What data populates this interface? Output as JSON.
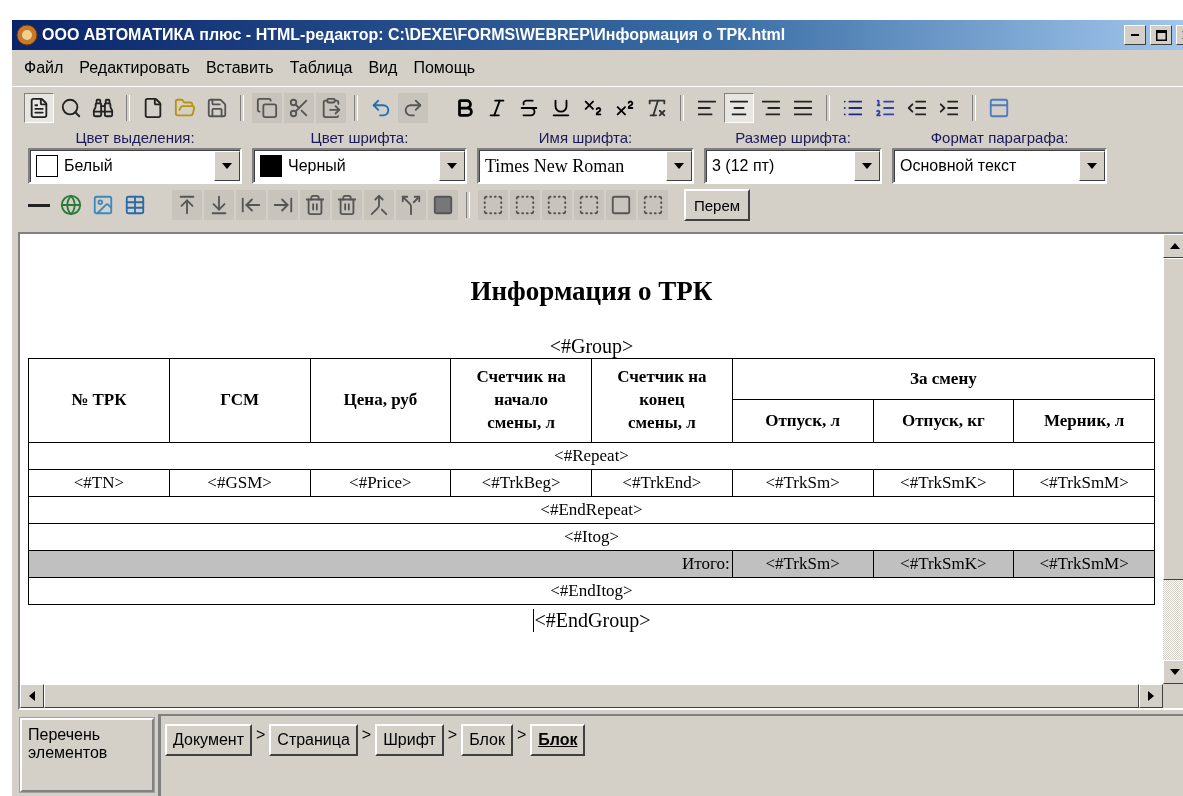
{
  "window": {
    "title": "ООО АВТОМАТИКА плюс - HTML-редактор: C:\\DEXE\\FORMS\\WEBREP\\Информация о ТРК.html"
  },
  "menu": [
    "Файл",
    "Редактировать",
    "Вставить",
    "Таблица",
    "Вид",
    "Помощь"
  ],
  "toolbar": [
    [
      {
        "kind": "edit-mode",
        "pressed": true,
        "disabled": false
      },
      {
        "kind": "preview",
        "pressed": false,
        "disabled": false
      },
      {
        "kind": "find",
        "pressed": false,
        "disabled": false
      }
    ],
    [
      {
        "kind": "new",
        "pressed": false,
        "disabled": false
      },
      {
        "kind": "open",
        "pressed": false,
        "disabled": false
      },
      {
        "kind": "save",
        "pressed": false,
        "disabled": false
      }
    ],
    [
      {
        "kind": "copy",
        "pressed": false,
        "disabled": true
      },
      {
        "kind": "cut",
        "pressed": false,
        "disabled": true
      },
      {
        "kind": "paste",
        "pressed": false,
        "disabled": true
      }
    ],
    [
      {
        "kind": "undo",
        "pressed": false,
        "disabled": false
      },
      {
        "kind": "redo",
        "pressed": false,
        "disabled": true
      }
    ],
    [
      {
        "kind": "bold",
        "pressed": false,
        "disabled": false
      },
      {
        "kind": "italic",
        "pressed": false,
        "disabled": false
      },
      {
        "kind": "strike",
        "pressed": false,
        "disabled": false
      },
      {
        "kind": "underline",
        "pressed": false,
        "disabled": false
      },
      {
        "kind": "subscript",
        "pressed": false,
        "disabled": false
      },
      {
        "kind": "superscript",
        "pressed": false,
        "disabled": false
      },
      {
        "kind": "clear-format",
        "pressed": false,
        "disabled": false
      }
    ],
    [
      {
        "kind": "align-left",
        "pressed": false,
        "disabled": false
      },
      {
        "kind": "align-center",
        "pressed": true,
        "disabled": false
      },
      {
        "kind": "align-right",
        "pressed": false,
        "disabled": false
      },
      {
        "kind": "justify",
        "pressed": false,
        "disabled": false
      }
    ],
    [
      {
        "kind": "bullets",
        "pressed": false,
        "disabled": false
      },
      {
        "kind": "numbering",
        "pressed": false,
        "disabled": false
      },
      {
        "kind": "outdent",
        "pressed": false,
        "disabled": false
      },
      {
        "kind": "indent",
        "pressed": false,
        "disabled": false
      }
    ],
    [
      {
        "kind": "layout",
        "pressed": false,
        "disabled": false
      }
    ]
  ],
  "selectors": [
    {
      "label": "Цвет выделения:",
      "value": "Белый",
      "color": "#ffffff"
    },
    {
      "label": "Цвет шрифта:",
      "value": "Черный",
      "color": "#000000"
    },
    {
      "label": "Имя шрифта:",
      "value": "Times New Roman",
      "kind": "font"
    },
    {
      "label": "Размер шрифта:",
      "value": "3 (12 пт)"
    },
    {
      "label": "Формат параграфа:",
      "value": "Основной текст"
    }
  ],
  "toolbar2": [
    [
      {
        "kind": "line",
        "disabled": false
      },
      {
        "kind": "link",
        "disabled": false
      },
      {
        "kind": "image",
        "disabled": false
      },
      {
        "kind": "table",
        "disabled": false
      }
    ],
    [
      {
        "kind": "row-above",
        "disabled": true
      },
      {
        "kind": "row-below",
        "disabled": true
      },
      {
        "kind": "col-left",
        "disabled": true
      },
      {
        "kind": "col-right",
        "disabled": true
      },
      {
        "kind": "del-row",
        "disabled": true
      },
      {
        "kind": "del-col",
        "disabled": true
      },
      {
        "kind": "merge",
        "disabled": true
      },
      {
        "kind": "split",
        "disabled": true
      },
      {
        "kind": "fill",
        "disabled": true
      }
    ],
    [
      {
        "kind": "border",
        "disabled": true
      },
      {
        "kind": "border",
        "disabled": true
      },
      {
        "kind": "border",
        "disabled": true
      },
      {
        "kind": "border",
        "disabled": true
      },
      {
        "kind": "frame",
        "disabled": true
      },
      {
        "kind": "border",
        "disabled": true
      }
    ]
  ],
  "variable_button": "Перем",
  "document": {
    "heading": "Информация о ТРК",
    "group_open": "<#Group>",
    "table": {
      "columns": [
        "№ ТРК",
        "ГСМ",
        "Цена, руб",
        "Счетчик на\nначало\nсмены, л",
        "Счетчик на\nконец\nсмены, л"
      ],
      "group": {
        "label": "За смену",
        "columns": [
          "Отпуск, л",
          "Отпуск, кг",
          "Мерник, л"
        ]
      },
      "rows": [
        {
          "kind": "tag",
          "text": "<#Repeat>"
        },
        {
          "kind": "cells",
          "cells": [
            "<#TN>",
            "<#GSM>",
            "<#Price>",
            "<#TrkBeg>",
            "<#TrkEnd>",
            "<#TrkSm>",
            "<#TrkSmK>",
            "<#TrkSmM>"
          ]
        },
        {
          "kind": "tag",
          "text": "<#EndRepeat>"
        },
        {
          "kind": "tag",
          "text": "<#Itog>"
        },
        {
          "kind": "total",
          "label": "Итого:",
          "cells": [
            "<#TrkSm>",
            "<#TrkSmK>",
            "<#TrkSmM>"
          ]
        },
        {
          "kind": "tag",
          "text": "<#EndItog>"
        }
      ]
    },
    "group_close": "<#EndGroup>"
  },
  "bottom": {
    "panel_label": "Перечень\nэлементов",
    "breadcrumbs": [
      {
        "label": "Документ",
        "separator": ">",
        "selected": false
      },
      {
        "label": "Страница",
        "separator": ">",
        "selected": false
      },
      {
        "label": "Шрифт",
        "separator": ">",
        "selected": false
      },
      {
        "label": "Блок",
        "separator": ">",
        "selected": false
      },
      {
        "label": "Блок",
        "selected": true
      }
    ]
  }
}
